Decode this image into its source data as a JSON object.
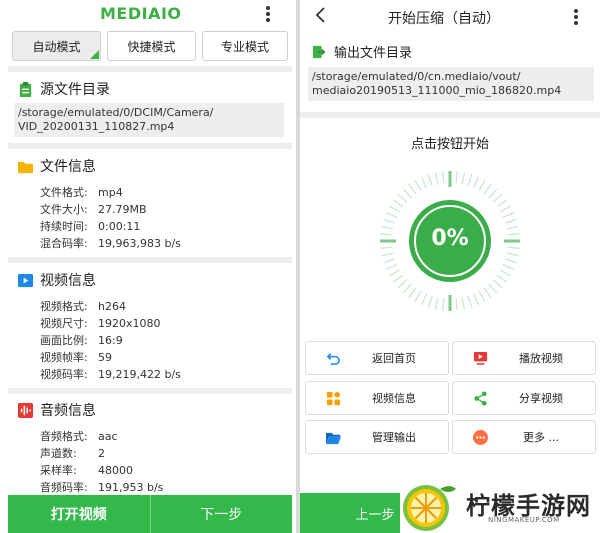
{
  "left": {
    "logo": "MEDIAIO",
    "modes": [
      "自动模式",
      "快捷模式",
      "专业模式"
    ],
    "source": {
      "title": "源文件目录",
      "path_line1": "/storage/emulated/0/DCIM/Camera/",
      "path_line2": "VID_20200131_110827.mp4"
    },
    "file_info": {
      "title": "文件信息",
      "rows": [
        {
          "k": "文件格式:",
          "v": "mp4"
        },
        {
          "k": "文件大小:",
          "v": "27.79MB"
        },
        {
          "k": "持续时间:",
          "v": "0:00:11"
        },
        {
          "k": "混合码率:",
          "v": "19,963,983 b/s"
        }
      ]
    },
    "video_info": {
      "title": "视频信息",
      "rows": [
        {
          "k": "视频格式:",
          "v": "h264"
        },
        {
          "k": "视频尺寸:",
          "v": "1920x1080"
        },
        {
          "k": "画面比例:",
          "v": "16:9"
        },
        {
          "k": "视频帧率:",
          "v": "59"
        },
        {
          "k": "视频码率:",
          "v": "19,219,422 b/s"
        }
      ]
    },
    "audio_info": {
      "title": "音频信息",
      "rows": [
        {
          "k": "音频格式:",
          "v": "aac"
        },
        {
          "k": "声道数:",
          "v": "2"
        },
        {
          "k": "采样率:",
          "v": "48000"
        },
        {
          "k": "音频码率:",
          "v": "191,953 b/s"
        }
      ]
    },
    "buttons": {
      "open": "打开视频",
      "next": "下一步"
    }
  },
  "right": {
    "title": "开始压缩（自动）",
    "output_label": "输出文件目录",
    "output_path_line1": "/storage/emulated/0/cn.mediaio/vout/",
    "output_path_line2": "mediaio20190513_111000_mio_186820.mp4",
    "hint": "点击按钮开始",
    "progress_text": "0%",
    "progress": 0,
    "actions": [
      "返回首页",
      "播放视频",
      "视频信息",
      "分享视频",
      "管理输出",
      "更多 ..."
    ],
    "prev": "上一步"
  },
  "watermark": {
    "name": "柠檬手游网",
    "url": "NINGMAKEUP.COM"
  },
  "colors": {
    "accent": "#33b949",
    "logo": "#3cb043",
    "info_icon": "#1e88e5",
    "audio_icon": "#e53935",
    "folder": "#f5b400"
  }
}
